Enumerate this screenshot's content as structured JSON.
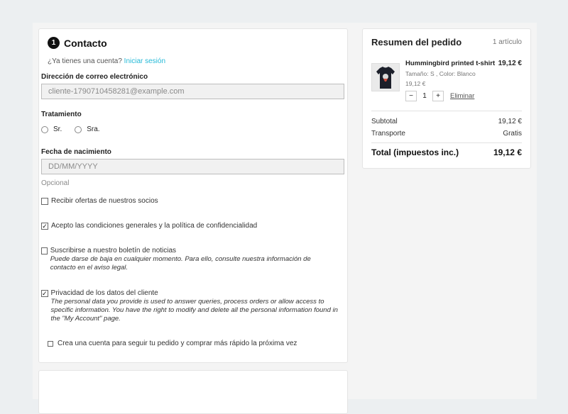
{
  "contact": {
    "step_number": "1",
    "title": "Contacto",
    "account_prompt": "¿Ya tienes una cuenta?",
    "login_link": "Iniciar sesión",
    "email_label": "Dirección de correo electrónico",
    "email_value": "cliente-1790710458281@example.com",
    "treatment_label": "Tratamiento",
    "treatment_options": [
      "Sr.",
      "Sra."
    ],
    "birthdate_label": "Fecha de nacimiento",
    "birthdate_placeholder": "DD/MM/YYYY",
    "optional_text": "Opcional",
    "checkboxes": [
      {
        "label": "Recibir ofertas de nuestros socios",
        "checked": false,
        "sub": ""
      },
      {
        "label": "Acepto las condiciones generales y la política de confidencialidad",
        "checked": true,
        "sub": ""
      },
      {
        "label": "Suscribirse a nuestro boletín de noticias",
        "checked": false,
        "sub": "Puede darse de baja en cualquier momento. Para ello, consulte nuestra información de contacto en el aviso legal."
      },
      {
        "label": "Privacidad de los datos del cliente",
        "checked": true,
        "sub": "The personal data you provide is used to answer queries, process orders or allow access to specific information. You have the right to modify and delete all the personal information found in the \"My Account\" page."
      },
      {
        "label": "Crea una cuenta para seguir tu pedido y comprar más rápido la próxima vez",
        "checked": false,
        "sub": ""
      }
    ]
  },
  "summary": {
    "title": "Resumen del pedido",
    "item_count": "1 artículo",
    "product": {
      "name": "Hummingbird printed t-shirt",
      "price": "19,12 €",
      "attributes": "Tamaño: S , Color: Blanco",
      "unit_price": "19,12 €",
      "quantity": "1",
      "decrease_label": "−",
      "increase_label": "+",
      "remove_label": "Eliminar"
    },
    "subtotal_label": "Subtotal",
    "subtotal_value": "19,12 €",
    "shipping_label": "Transporte",
    "shipping_value": "Gratis",
    "total_label": "Total (impuestos inc.)",
    "total_value": "19,12 €"
  },
  "colors": {
    "accent_link": "#24b9d7",
    "step_badge": "#111111",
    "page_background": "#eceff1"
  }
}
